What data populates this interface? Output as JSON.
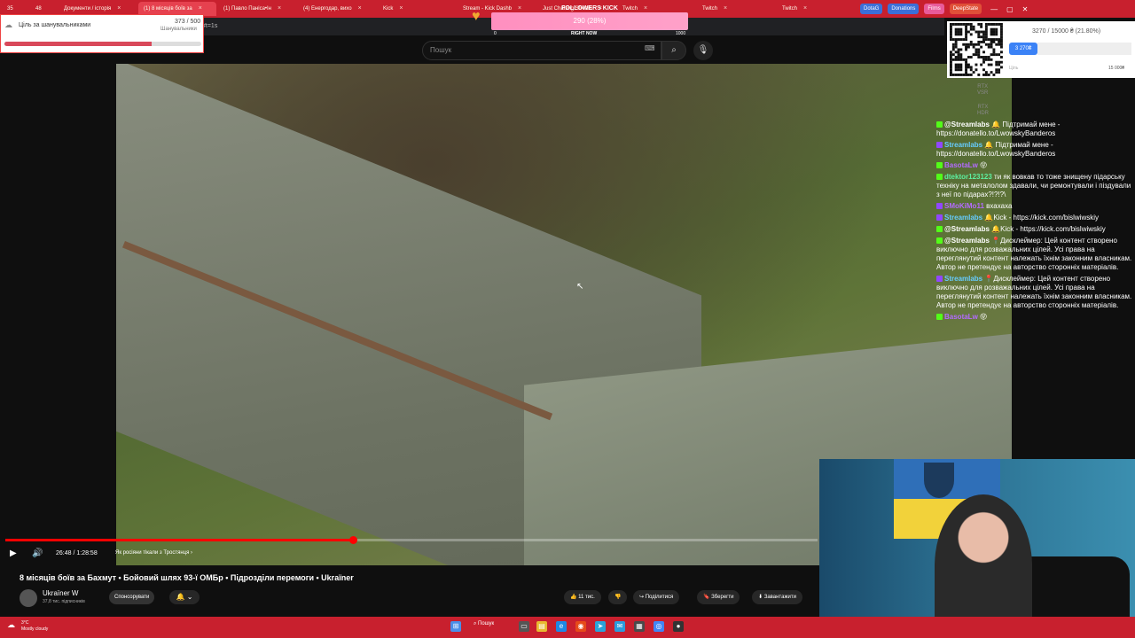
{
  "browser": {
    "tabs": [
      {
        "label": "35",
        "active": false
      },
      {
        "label": "48",
        "active": false
      },
      {
        "label": "Документи / історія",
        "active": false
      },
      {
        "label": "(1) 8 місяців боїв за",
        "active": true
      },
      {
        "label": "(1) Павло Паніса•Ін",
        "active": false
      },
      {
        "label": "(4) Енергодар, вихо",
        "active": false
      },
      {
        "label": "Kick",
        "active": false
      },
      {
        "label": "Stream - Kick Dashb",
        "active": false
      },
      {
        "label": "Just Chatting Stream",
        "active": false
      },
      {
        "label": "Twitch",
        "active": false
      },
      {
        "label": "Twitch",
        "active": false
      },
      {
        "label": "Twitch",
        "active": false
      }
    ],
    "pills": [
      "DotaG",
      "Donations",
      "Films",
      "DeepState"
    ],
    "address_fragment": "#t=1s"
  },
  "goal_widget": {
    "title": "Ціль за шанувальниками",
    "count": "373 / 500",
    "subtitle": "Шанувальники",
    "progress": 0.746
  },
  "followers_kick": {
    "label": "FOLLOWERS KICK",
    "value_text": "290 (28%)",
    "min": "0",
    "mid": "RIGHT NOW",
    "max": "1000",
    "progress": 0.28
  },
  "search": {
    "placeholder": "Пошук"
  },
  "video": {
    "time": "26:48 / 1:28:58",
    "chapter": "Як росіяни тікали з Тростянця",
    "progress": 0.428,
    "title": "8 місяців боїв за Бахмут • Бойовий шлях 93-ї ОМБр • Підрозділи перемоги • Ukraïner",
    "channel": "Ukraïner W",
    "subscribers": "37,8 тис. підписників",
    "sponsor": "Спонсорувати",
    "likes": "11 тис.",
    "share": "Поділитися",
    "save": "Зберегти",
    "download": "Завантажити",
    "rtx1": "RTX\nVSR",
    "rtx2": "RTX\nHDR"
  },
  "donation": {
    "title": "3270 / 15000 ₴ (21.80%)",
    "button": "3 270₴",
    "min_label": "Ціль",
    "max_label": "15 000₴"
  },
  "chat": [
    {
      "user": "@Streamlabs",
      "color": "#ffffff",
      "badge": "#53fc18",
      "text": "🔔 Підтримай мене - https://donatello.to/LwowskyBanderos"
    },
    {
      "user": "Streamlabs",
      "color": "#6cf",
      "badge": "#9147ff",
      "text": "🔔 Підтримай мене - https://donatello.to/LwowskyBanderos"
    },
    {
      "user": "BasotaLw",
      "color": "#b36bff",
      "badge": "#53fc18",
      "text": "😝"
    },
    {
      "user": "dtektor123123",
      "color": "#5df0a0",
      "badge": "#53fc18",
      "text": "ти як вовкав то тоже знищену підарську техніку на металолом здавали, чи ремонтували і піздували з неї по підарах?!?!?\\"
    },
    {
      "user": "SMoKiMo11",
      "color": "#b36bff",
      "badge": "#9147ff",
      "text": "вхахаха"
    },
    {
      "user": "Streamlabs",
      "color": "#6cf",
      "badge": "#9147ff",
      "text": "🔔Kick - https://kick.com/bislwiwskiy"
    },
    {
      "user": "@Streamlabs",
      "color": "#ffffff",
      "badge": "#53fc18",
      "text": "🔔Kick - https://kick.com/bislwiwskiy"
    },
    {
      "user": "@Streamlabs",
      "color": "#ffffff",
      "badge": "#53fc18",
      "text": "📍Дисклеймер: Цей контент створено виключно для розважальних цілей. Усі права на переглянутий контент належать їхнім законним власникам. Автор не претендує на авторство сторонніх матеріалів."
    },
    {
      "user": "Streamlabs",
      "color": "#6cf",
      "badge": "#9147ff",
      "text": "📍Дисклеймер: Цей контент створено виключно для розважальних цілей. Усі права на переглянутий контент належать їхнім законним власникам. Автор не претендує на авторство сторонніх матеріалів."
    },
    {
      "user": "BasotaLw",
      "color": "#b36bff",
      "badge": "#53fc18",
      "text": "😝"
    }
  ],
  "taskbar": {
    "weather_temp": "3°C",
    "weather_desc": "Mostly cloudy",
    "search": "Пошук"
  },
  "colors": {
    "accent_red": "#c8202e",
    "kick_green": "#53fc18",
    "twitch_purple": "#9147ff"
  }
}
